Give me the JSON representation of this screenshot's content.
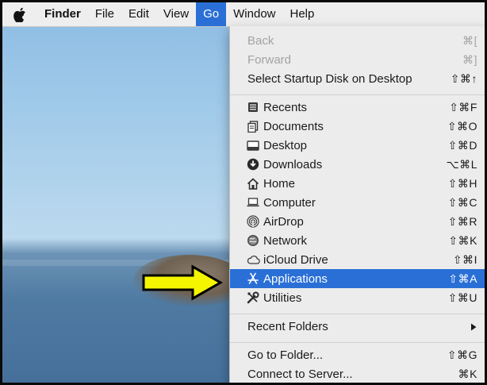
{
  "menubar": {
    "apple_icon": "apple-icon",
    "items": [
      {
        "label": "Finder"
      },
      {
        "label": "File"
      },
      {
        "label": "Edit"
      },
      {
        "label": "View"
      },
      {
        "label": "Go"
      },
      {
        "label": "Window"
      },
      {
        "label": "Help"
      }
    ],
    "active_item": "Go"
  },
  "go_menu": {
    "nav_items": [
      {
        "label": "Back",
        "shortcut": "⌘[",
        "enabled": false
      },
      {
        "label": "Forward",
        "shortcut": "⌘]",
        "enabled": false
      },
      {
        "label": "Select Startup Disk on Desktop",
        "shortcut": "⇧⌘↑",
        "enabled": true
      }
    ],
    "places": [
      {
        "label": "Recents",
        "shortcut": "⇧⌘F",
        "icon": "recents-icon"
      },
      {
        "label": "Documents",
        "shortcut": "⇧⌘O",
        "icon": "documents-icon"
      },
      {
        "label": "Desktop",
        "shortcut": "⇧⌘D",
        "icon": "desktop-icon"
      },
      {
        "label": "Downloads",
        "shortcut": "⌥⌘L",
        "icon": "downloads-icon"
      },
      {
        "label": "Home",
        "shortcut": "⇧⌘H",
        "icon": "home-icon"
      },
      {
        "label": "Computer",
        "shortcut": "⇧⌘C",
        "icon": "computer-icon"
      },
      {
        "label": "AirDrop",
        "shortcut": "⇧⌘R",
        "icon": "airdrop-icon"
      },
      {
        "label": "Network",
        "shortcut": "⇧⌘K",
        "icon": "network-icon"
      },
      {
        "label": "iCloud Drive",
        "shortcut": "⇧⌘I",
        "icon": "icloud-icon"
      },
      {
        "label": "Applications",
        "shortcut": "⇧⌘A",
        "icon": "applications-icon",
        "highlighted": true
      },
      {
        "label": "Utilities",
        "shortcut": "⇧⌘U",
        "icon": "utilities-icon"
      }
    ],
    "recent_folders": {
      "label": "Recent Folders",
      "submenu_icon": "chevron-right-icon"
    },
    "folder_items": [
      {
        "label": "Go to Folder...",
        "shortcut": "⇧⌘G"
      },
      {
        "label": "Connect to Server...",
        "shortcut": "⌘K"
      }
    ]
  },
  "annotation": {
    "icon": "yellow-arrow-icon",
    "color": "#f5f500"
  },
  "colors": {
    "highlight": "#2a6fd6",
    "menu_bg": "#ececec",
    "disabled_text": "#a3a3a3"
  }
}
